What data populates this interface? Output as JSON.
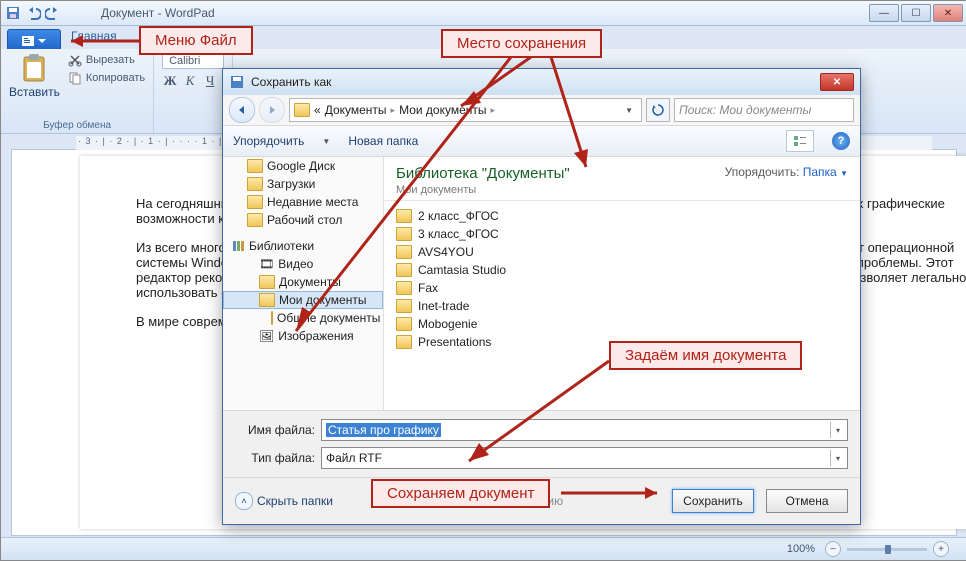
{
  "window": {
    "title": "Документ - WordPad"
  },
  "ribbon": {
    "tab_home": "Главная",
    "paste": "Вставить",
    "cut": "Вырезать",
    "copy": "Копировать",
    "clipboard_group": "Буфер обмена",
    "font_name": "Calibri",
    "bold": "Ж",
    "italic": "К",
    "underline": "Ч"
  },
  "ruler_text": "· 3 · | · 2 · | · 1 · | · · · · 1 · | · 2 · | · 3 · | · 4 · | · 5 · | · 6 · | · 7 · | · 8 · | · 9 · | · 10 · | · 11",
  "doc": {
    "p1": "На сегодняшний день существует огромное количество графических редакторов и различных программ, использующих графические возможности компьютера, в том числе и 3D-графику.",
    "p2": "Из всего многообразия графических редакторов следует выделить редактор Paint, который входит в стандартный пакет операционной системы Windows. Этот редактор является простейшим, но тем не менее позволяет реализовать многие графические проблемы. Этот редактор рекомендуется для изучения в школе, он является лицензионным, в отличие от большинства других, и это позволяет легально использовать его на уроках информатики.",
    "p3": "В мире современных технологий компьютерная графика, как инструмент, практически заменила карандаш и линейку."
  },
  "status": {
    "zoom": "100%"
  },
  "dialog": {
    "title": "Сохранить как",
    "breadcrumb": {
      "a": "Документы",
      "b": "Мои документы"
    },
    "search_placeholder": "Поиск: Мои документы",
    "organize": "Упорядочить",
    "newfolder": "Новая папка",
    "library_title": "Библиотека \"Документы\"",
    "library_sub": "Мои документы",
    "sort_label": "Упорядочить:",
    "sort_value": "Папка",
    "tree": {
      "gdrive": "Google Диск",
      "downloads": "Загрузки",
      "recent": "Недавние места",
      "desktop": "Рабочий стол",
      "libraries": "Библиотеки",
      "video": "Видео",
      "documents": "Документы",
      "mydocs": "Мои документы",
      "publicdocs": "Общие документы",
      "pictures": "Изображения"
    },
    "folders": [
      "2 класс_ФГОС",
      "3 класс_ФГОС",
      "AVS4YOU",
      "Camtasia Studio",
      "Fax",
      "Inet-trade",
      "Mobogenie",
      "Presentations"
    ],
    "filename_label": "Имя файла:",
    "filename_value": "Статья про графику",
    "filetype_label": "Тип файла:",
    "filetype_value": "Файл RTF",
    "default_chk": "По умолчанию",
    "hide_folders": "Скрыть папки",
    "save": "Сохранить",
    "cancel": "Отмена"
  },
  "callouts": {
    "file_menu": "Меню Файл",
    "save_location": "Место сохранения",
    "set_name": "Задаём имя документа",
    "save_doc": "Сохраняем документ"
  }
}
